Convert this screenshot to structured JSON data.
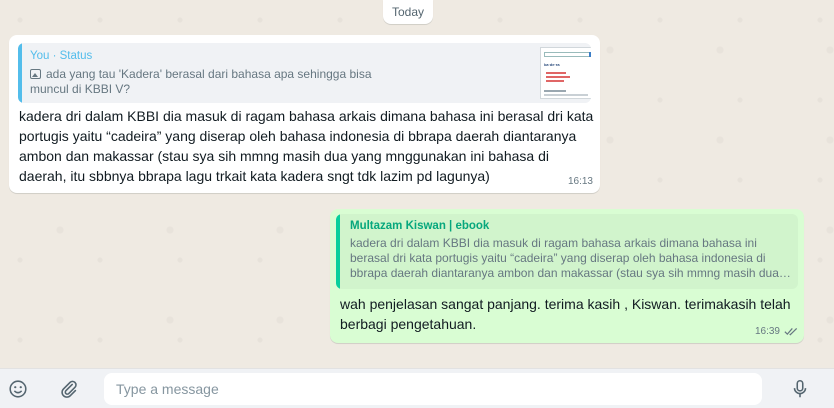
{
  "date_chip": "Today",
  "incoming": {
    "quote_author": "You · Status",
    "quote_text": "ada yang tau 'Kadera' berasal dari bahasa apa sehingga bisa muncul di KBBI V?",
    "quote_thumb_word": "ka·de·ra",
    "text": "kadera dri dalam KBBI dia masuk di ragam bahasa arkais dimana bahasa ini berasal dri kata portugis yaitu “cadeira” yang diserap oleh bahasa indonesia di bbrapa daerah diantaranya ambon dan makassar (stau sya sih mmng masih dua yang mnggunakan ini bahasa di daerah, itu sbbnya bbrapa lagu trkait kata kadera sngt tdk lazim pd lagunya)",
    "time": "16:13"
  },
  "outgoing": {
    "quote_author": "Multazam Kiswan | ebook",
    "quote_text": "kadera dri dalam KBBI dia masuk di ragam bahasa arkais dimana bahasa ini berasal dri kata portugis yaitu “cadeira” yang diserap oleh bahasa indonesia di bbrapa daerah diantaranya ambon dan makassar (stau sya sih mmng masih dua yang mnggunakan ini bahasa di daerah, itu sbbnya bbrapa lagu trkait kata kadera sngt tdk lazim pd lagunya)",
    "text": "wah penjelasan sangat panjang. terima kasih , Kiswan. terimakasih telah berbagi pengetahuan.",
    "time": "16:39",
    "status_icon": "double-check-icon"
  },
  "composer": {
    "placeholder": "Type a message",
    "emoji_icon": "emoji-icon",
    "attach_icon": "paperclip-icon",
    "mic_icon": "microphone-icon"
  },
  "colors": {
    "incoming_bubble": "#ffffff",
    "outgoing_bubble": "#d9fdd3",
    "incoming_quote_accent": "#53bdeb",
    "outgoing_quote_accent": "#06cf9c",
    "chat_background": "#efeae2"
  }
}
